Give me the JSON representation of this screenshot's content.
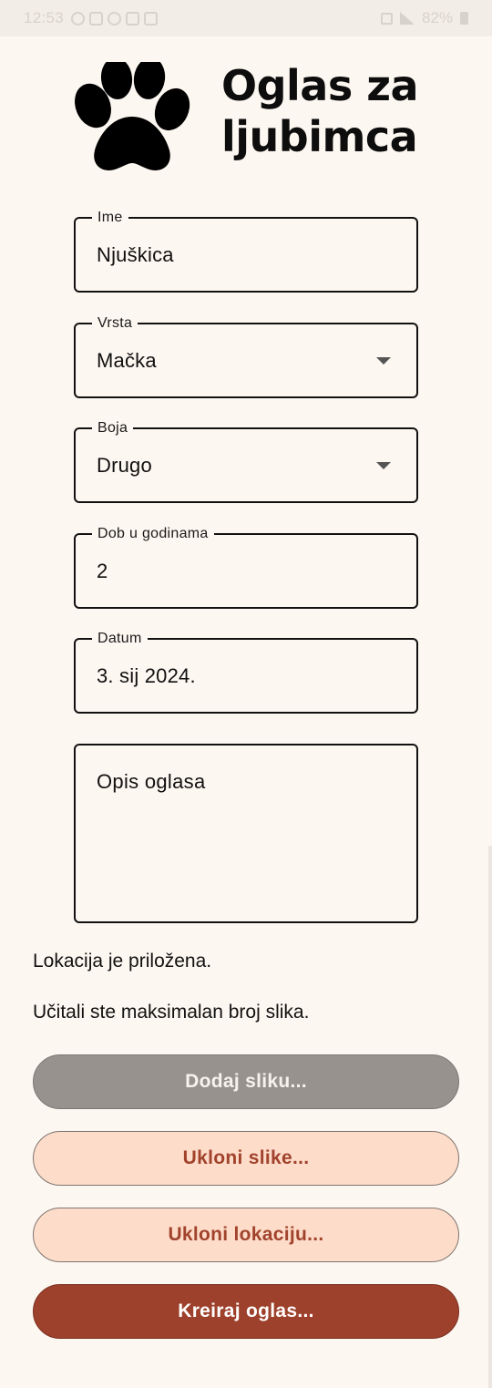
{
  "status_bar": {
    "time": "12:53",
    "battery": "82%"
  },
  "header": {
    "icon": "paw-icon",
    "title": "Oglas za\nljubimca"
  },
  "form": {
    "name": {
      "label": "Ime",
      "value": "Njuškica"
    },
    "species": {
      "label": "Vrsta",
      "value": "Mačka"
    },
    "color": {
      "label": "Boja",
      "value": "Drugo"
    },
    "age": {
      "label": "Dob u godinama",
      "value": "2"
    },
    "date": {
      "label": "Datum",
      "value": "3. sij 2024."
    },
    "description": {
      "placeholder": "Opis oglasa"
    }
  },
  "info": {
    "location": "Lokacija je priložena.",
    "images": "Učitali ste maksimalan broj slika."
  },
  "buttons": {
    "add_image": "Dodaj sliku...",
    "remove_images": "Ukloni slike...",
    "remove_location": "Ukloni lokaciju...",
    "create_ad": "Kreiraj oglas..."
  },
  "colors": {
    "background": "#fdf7f1",
    "primary": "#9e412c",
    "outline_button_bg": "#fddcc9",
    "outline_button_text": "#a1432c",
    "disabled_button": "#97928e"
  }
}
